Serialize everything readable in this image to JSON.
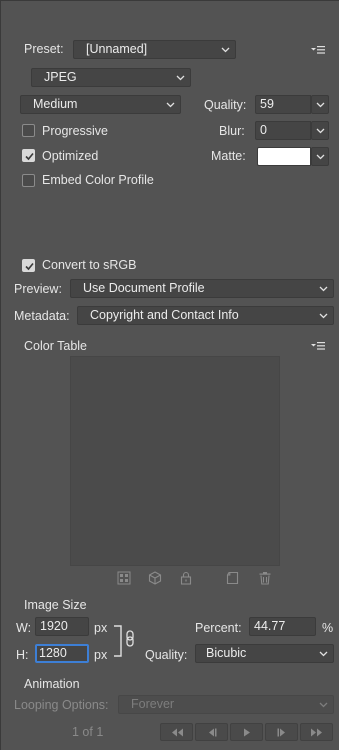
{
  "preset": {
    "label": "Preset:",
    "value": "[Unnamed]",
    "menu_icon": "panel-menu-icon"
  },
  "format": {
    "value": "JPEG"
  },
  "compression": {
    "value": "Medium"
  },
  "quality": {
    "label": "Quality:",
    "value": "59"
  },
  "blur": {
    "label": "Blur:",
    "value": "0"
  },
  "matte": {
    "label": "Matte:",
    "color": "#ffffff"
  },
  "options": {
    "progressive": {
      "label": "Progressive",
      "checked": false
    },
    "optimized": {
      "label": "Optimized",
      "checked": true
    },
    "embed_color_profile": {
      "label": "Embed Color Profile",
      "checked": false
    },
    "convert_srgb": {
      "label": "Convert to sRGB",
      "checked": true
    }
  },
  "preview": {
    "label": "Preview:",
    "value": "Use Document Profile"
  },
  "metadata": {
    "label": "Metadata:",
    "value": "Copyright and Contact Info"
  },
  "color_table": {
    "label": "Color Table",
    "tools": [
      "map-colors-icon",
      "web-shift-icon",
      "lock-color-icon",
      "new-color-icon",
      "trash-icon"
    ]
  },
  "image_size": {
    "label": "Image Size",
    "w_label": "W:",
    "w_value": "1920",
    "w_unit": "px",
    "h_label": "H:",
    "h_value": "1280",
    "h_unit": "px",
    "percent_label": "Percent:",
    "percent_value": "44.77",
    "percent_unit": "%",
    "quality_label": "Quality:",
    "quality_value": "Bicubic"
  },
  "animation": {
    "label": "Animation",
    "looping_label": "Looping Options:",
    "looping_value": "Forever",
    "frame_counter": "1 of 1"
  },
  "colors": {
    "panel": "#535353",
    "field": "#454545",
    "focus": "#3d7fd6"
  }
}
